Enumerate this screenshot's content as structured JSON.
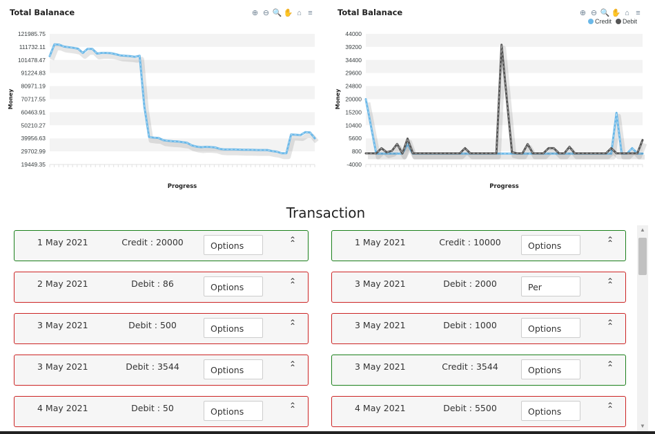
{
  "charts": [
    {
      "title": "Total Balanace",
      "ylabel": "Money",
      "xlabel": "Progress",
      "toolbar": [
        "zoom-in-icon",
        "zoom-out-icon",
        "zoom-icon",
        "pan-icon",
        "home-icon",
        "menu-icon"
      ],
      "chart_data": {
        "type": "line",
        "title": "Total Balanace",
        "xlabel": "Progress",
        "ylabel": "Money",
        "ylim": [
          19449.35,
          121985.75
        ],
        "y_ticks": [
          "121985.75",
          "111732.11",
          "101478.47",
          "91224.83",
          "80971.19",
          "70717.55",
          "60463.91",
          "50210.27",
          "39956.63",
          "29702.99",
          "19449.35"
        ],
        "series": [
          {
            "values": [
              104500,
              113800,
              113500,
              112000,
              111500,
              111000,
              110300,
              107000,
              110200,
              110200,
              106500,
              107000,
              107000,
              106800,
              106000,
              105000,
              104800,
              104500,
              104000,
              104800,
              65000,
              41000,
              40500,
              40300,
              38500,
              38000,
              37700,
              37500,
              37000,
              36500,
              34500,
              33500,
              33000,
              33300,
              33100,
              32800,
              31600,
              31300,
              31300,
              31200,
              31100,
              31000,
              31000,
              30900,
              30800,
              30800,
              30800,
              30000,
              29500,
              28300,
              28300,
              43000,
              42800,
              42500,
              44800,
              44600,
              40000
            ],
            "color": "#6bb8e8"
          }
        ],
        "grid": true
      }
    },
    {
      "title": "Total Balanace",
      "ylabel": "Money",
      "xlabel": "Progress",
      "toolbar": [
        "zoom-in-icon",
        "zoom-out-icon",
        "zoom-icon",
        "pan-icon",
        "home-icon",
        "menu-icon"
      ],
      "chart_data": {
        "type": "line",
        "title": "Total Balanace",
        "xlabel": "Progress",
        "ylabel": "Money",
        "ylim": [
          -4000,
          44000
        ],
        "y_ticks": [
          "44000",
          "39200",
          "34400",
          "29600",
          "24800",
          "20000",
          "15200",
          "10400",
          "5600",
          "800",
          "-4000"
        ],
        "legend_position": "top-right",
        "series": [
          {
            "name": "Credit",
            "color": "#6bb8e8",
            "values": [
              20000,
              10000,
              0,
              0,
              0,
              0,
              0,
              0,
              3544,
              0,
              0,
              0,
              0,
              0,
              0,
              0,
              0,
              0,
              0,
              0,
              0,
              0,
              0,
              0,
              0,
              0,
              0,
              0,
              0,
              0,
              0,
              0,
              0,
              0,
              0,
              0,
              0,
              0,
              0,
              0,
              0,
              0,
              0,
              0,
              0,
              0,
              0,
              0,
              15000,
              0,
              0,
              2000,
              0,
              0
            ]
          },
          {
            "name": "Debit",
            "color": "#555555",
            "values": [
              86,
              86,
              86,
              2000,
              500,
              1000,
              3544,
              50,
              5500,
              86,
              86,
              86,
              86,
              86,
              86,
              86,
              86,
              86,
              86,
              2000,
              86,
              86,
              86,
              86,
              86,
              86,
              40000,
              20000,
              500,
              86,
              86,
              3500,
              86,
              86,
              86,
              2000,
              2000,
              86,
              86,
              2500,
              86,
              86,
              86,
              86,
              86,
              86,
              86,
              2000,
              86,
              86,
              86,
              86,
              86,
              5000
            ]
          }
        ],
        "grid": true
      }
    }
  ],
  "section_title": "Transaction",
  "option_placeholder": "Options",
  "transactions_left": [
    {
      "date": "1 May 2021",
      "amount": "Credit : 20000",
      "type": "credit",
      "option": "Options"
    },
    {
      "date": "2 May 2021",
      "amount": "Debit : 86",
      "type": "debit",
      "option": "Options"
    },
    {
      "date": "3 May 2021",
      "amount": "Debit : 500",
      "type": "debit",
      "option": "Options"
    },
    {
      "date": "3 May 2021",
      "amount": "Debit : 3544",
      "type": "debit",
      "option": "Options"
    },
    {
      "date": "4 May 2021",
      "amount": "Debit : 50",
      "type": "debit",
      "option": "Options"
    }
  ],
  "transactions_right": [
    {
      "date": "1 May 2021",
      "amount": "Credit : 10000",
      "type": "credit",
      "option": "Options"
    },
    {
      "date": "3 May 2021",
      "amount": "Debit : 2000",
      "type": "debit",
      "option": "Per"
    },
    {
      "date": "3 May 2021",
      "amount": "Debit : 1000",
      "type": "debit",
      "option": "Options"
    },
    {
      "date": "3 May 2021",
      "amount": "Credit : 3544",
      "type": "credit",
      "option": "Options"
    },
    {
      "date": "4 May 2021",
      "amount": "Debit : 5500",
      "type": "debit",
      "option": "Options"
    }
  ],
  "colors": {
    "credit_border": "#1a7f1a",
    "debit_border": "#cc2222",
    "credit_line": "#6bb8e8",
    "debit_line": "#555555"
  }
}
